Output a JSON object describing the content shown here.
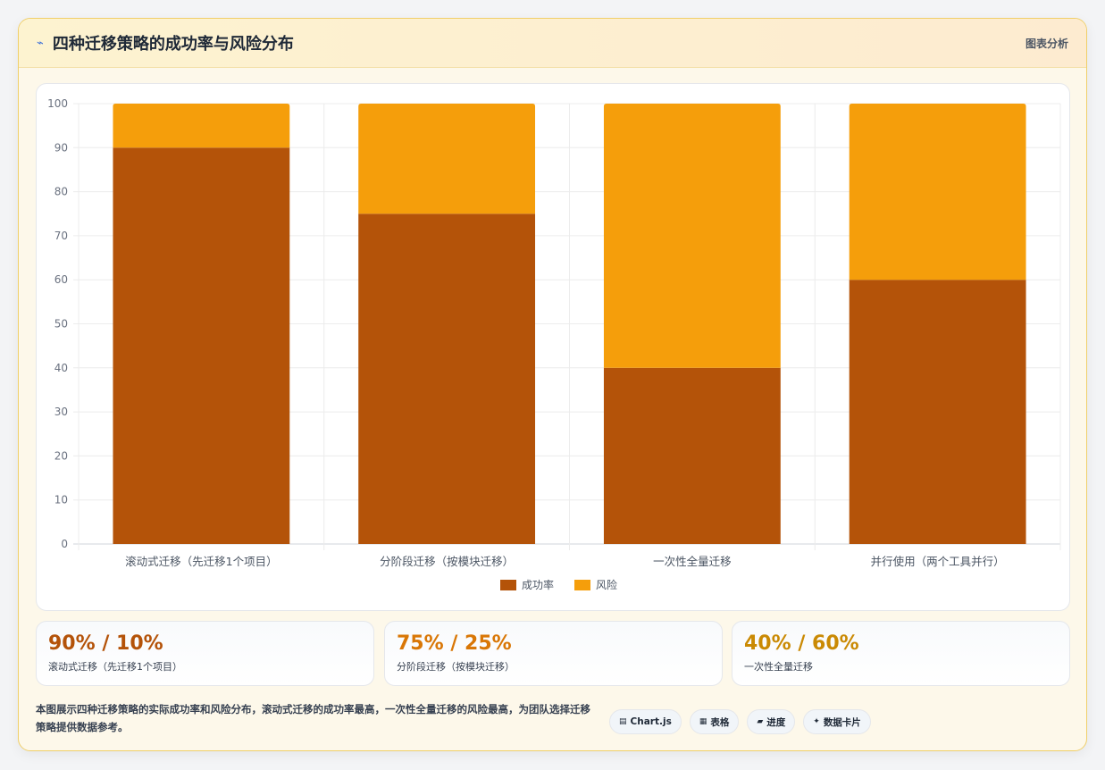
{
  "header": {
    "title": "四种迁移策略的成功率与风险分布",
    "tag": "图表分析"
  },
  "chart_data": {
    "type": "bar",
    "stacked": true,
    "categories": [
      "滚动式迁移（先迁移1个项目）",
      "分阶段迁移（按模块迁移）",
      "一次性全量迁移",
      "并行使用（两个工具并行）"
    ],
    "series": [
      {
        "name": "成功率",
        "values": [
          90,
          75,
          40,
          60
        ],
        "color": "#b45309"
      },
      {
        "name": "风险",
        "values": [
          10,
          25,
          60,
          40
        ],
        "color": "#f59e0b"
      }
    ],
    "ylim": [
      0,
      100
    ],
    "yticks": [
      0,
      10,
      20,
      30,
      40,
      50,
      60,
      70,
      80,
      90,
      100
    ],
    "grid": true,
    "legend_position": "bottom"
  },
  "stats": [
    {
      "value": "90% / 10%",
      "label": "滚动式迁移（先迁移1个项目）",
      "color": "#b45309"
    },
    {
      "value": "75% / 25%",
      "label": "分阶段迁移（按模块迁移）",
      "color": "#d97706"
    },
    {
      "value": "40% / 60%",
      "label": "一次性全量迁移",
      "color": "#ca8a04"
    }
  ],
  "description": "本图展示四种迁移策略的实际成功率和风险分布，滚动式迁移的成功率最高，一次性全量迁移的风险最高，为团队选择迁移策略提供数据参考。",
  "chips": [
    {
      "icon": "▤",
      "label": "Chart.js"
    },
    {
      "icon": "▦",
      "label": "表格"
    },
    {
      "icon": "▰",
      "label": "进度"
    },
    {
      "icon": "✦",
      "label": "数据卡片"
    }
  ]
}
